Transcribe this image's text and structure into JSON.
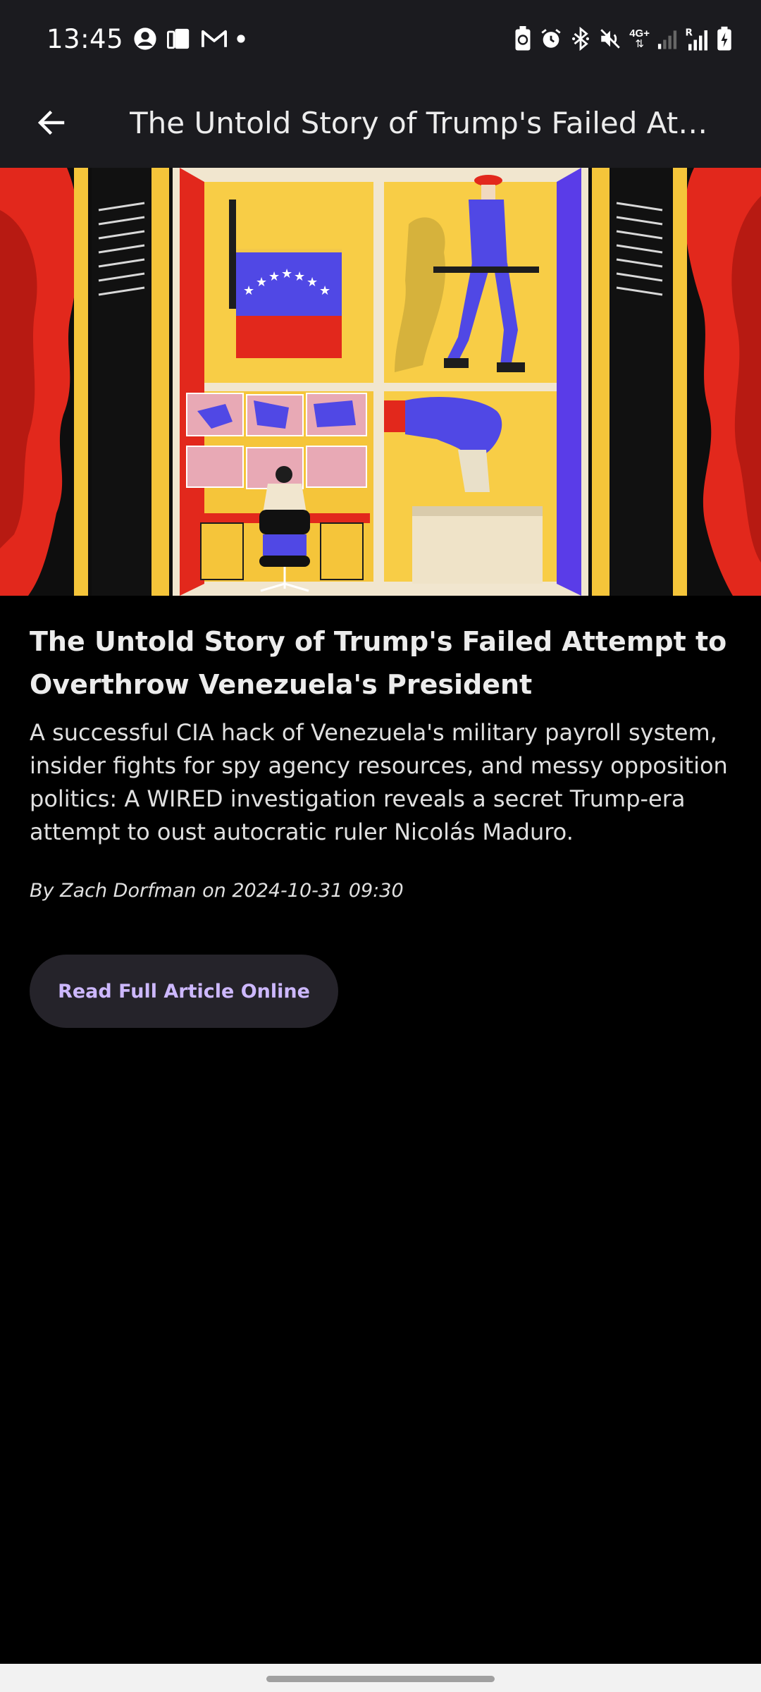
{
  "status_bar": {
    "time": "13:45",
    "network_label": "4G+"
  },
  "app_bar": {
    "back_icon": "arrow-back-icon",
    "title": "The Untold Story of Trump's Failed Attempt to Overthrow Venezuela's President"
  },
  "article": {
    "headline": "The Untold Story of Trump's Failed Attempt to Overthrow Venezuela's President",
    "summary": "A successful CIA hack of Venezuela's military payroll system, insider fights for spy agency resources, and messy opposition politics: A WIRED investigation reveals a secret Trump-era attempt to oust autocratic ruler Nicolás Maduro.",
    "byline": "By Zach Dorfman on 2024-10-31 09:30",
    "read_button_label": "Read Full Article Online"
  },
  "colors": {
    "background": "#000000",
    "app_bar": "#1b1b1f",
    "button_bg": "#25232a",
    "button_text": "#cdb8ff"
  }
}
